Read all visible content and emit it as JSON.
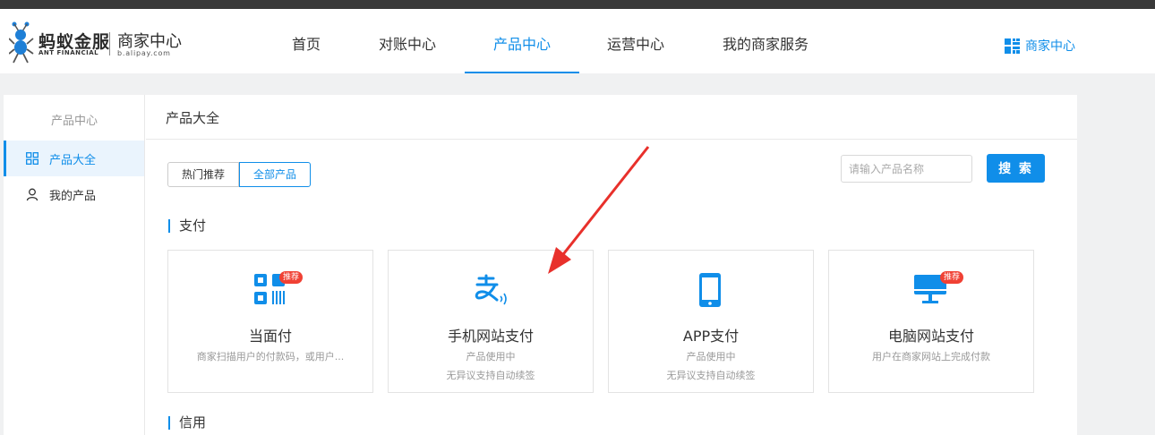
{
  "header": {
    "brand_cn": "蚂蚁金服",
    "brand_en": "ANT FINANCIAL",
    "merchant_title": "商家中心",
    "domain": "b.alipay.com",
    "nav": [
      {
        "label": "首页"
      },
      {
        "label": "对账中心"
      },
      {
        "label": "产品中心",
        "active": true
      },
      {
        "label": "运营中心"
      },
      {
        "label": "我的商家服务"
      }
    ],
    "right_link": "商家中心"
  },
  "sidebar": {
    "title": "产品中心",
    "items": [
      {
        "label": "产品大全",
        "active": true,
        "icon": "grid-icon"
      },
      {
        "label": "我的产品",
        "active": false,
        "icon": "user-icon"
      }
    ]
  },
  "main": {
    "title": "产品大全",
    "tabs": [
      {
        "label": "热门推荐",
        "active": false
      },
      {
        "label": "全部产品",
        "active": true
      }
    ],
    "search": {
      "placeholder": "请输入产品名称",
      "button": "搜 索"
    },
    "sections": [
      {
        "title": "支付",
        "cards": [
          {
            "name": "当面付",
            "desc1": "商家扫描用户的付款码，或用户...",
            "desc2": "",
            "badge": "推荐",
            "icon": "qr-scan-icon"
          },
          {
            "name": "手机网站支付",
            "desc1": "产品使用中",
            "desc2": "无异议支持自动续签",
            "badge": "",
            "icon": "alipay-wave-icon"
          },
          {
            "name": "APP支付",
            "desc1": "产品使用中",
            "desc2": "无异议支持自动续签",
            "badge": "",
            "icon": "mobile-phone-icon"
          },
          {
            "name": "电脑网站支付",
            "desc1": "用户在商家网站上完成付款",
            "desc2": "",
            "badge": "推荐",
            "icon": "desktop-monitor-icon"
          }
        ]
      },
      {
        "title": "信用"
      }
    ]
  },
  "colors": {
    "accent": "#108ee9",
    "badge": "#f04134",
    "annotation_arrow": "#e8302b",
    "topbar": "#393939"
  }
}
